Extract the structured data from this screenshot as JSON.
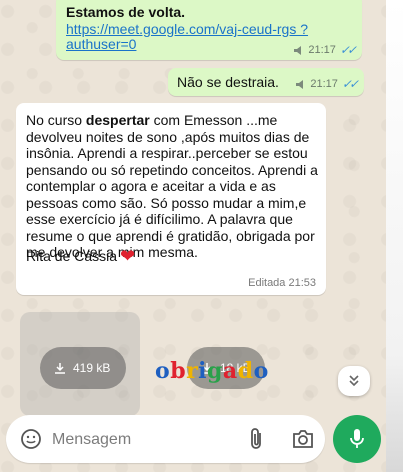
{
  "messages": {
    "m1": {
      "title": "Estamos de volta.",
      "link": "https://meet.google.com/vaj-ceud-rgs ?authuser=0",
      "time": "21:17"
    },
    "m2": {
      "text": "Não se destraia.",
      "time": "21:17"
    },
    "m3": {
      "body_before": "No curso ",
      "body_bold": "despertar",
      "body_after": " com Emesson ...me devolveu noites de sono ,após muitos dias de insônia. Aprendi a respirar..perceber se estou pensando ou só repetindo conceitos. Aprendi a contemplar o agora e aceitar a vida e as pessoas como são. Só posso mudar a mim,e esse exercício já é difícilimo. A palavra que resume o que aprendi é gratidão, obrigada por me devolver a mim mesma.",
      "signature": "Rita de Cássia",
      "heart": "❤",
      "edited": "Editada 21:53"
    }
  },
  "media": {
    "file1_size": "419 kB",
    "file2_size": "18 kB"
  },
  "watermark": [
    "o",
    "b",
    "r",
    "i",
    "g",
    "a",
    "d",
    "o"
  ],
  "composer": {
    "placeholder": "Mensagem"
  },
  "colors": {
    "outgoing_bubble": "#dcf8c6",
    "incoming_bubble": "#ffffff",
    "link": "#1a73c9",
    "read_ticks": "#3a90d6",
    "send_button": "#1faa5d"
  },
  "icons": [
    "voice-note-icon",
    "double-check-icon",
    "download-icon",
    "chevron-double-down-icon",
    "emoji-icon",
    "paperclip-icon",
    "camera-icon",
    "microphone-icon"
  ]
}
